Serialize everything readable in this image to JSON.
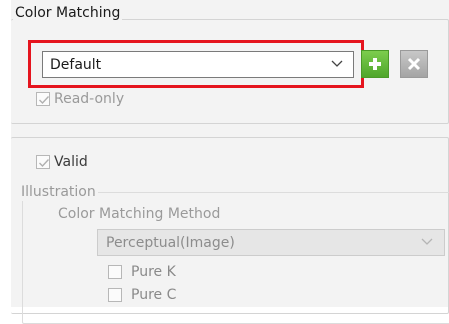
{
  "color_matching": {
    "group_title": "Color Matching",
    "profile_select": {
      "selected": "Default"
    },
    "add_button": {
      "icon": "plus-icon",
      "color": "#5fb832"
    },
    "delete_button": {
      "icon": "x-icon",
      "color": "#a9a9a9"
    },
    "read_only": {
      "label": "Read-only",
      "checked": true
    }
  },
  "valid": {
    "label": "Valid",
    "checked": true
  },
  "illustration": {
    "group_title": "Illustration",
    "method_label": "Color Matching Method",
    "method_select": {
      "selected": "Perceptual(Image)"
    },
    "options": [
      {
        "label": "Pure K",
        "checked": false
      },
      {
        "label": "Pure C",
        "checked": false
      }
    ]
  },
  "colors": {
    "highlight": "#e5141e",
    "disabled_text": "#9a9a9a",
    "panel_bg": "#f3f3f3"
  }
}
